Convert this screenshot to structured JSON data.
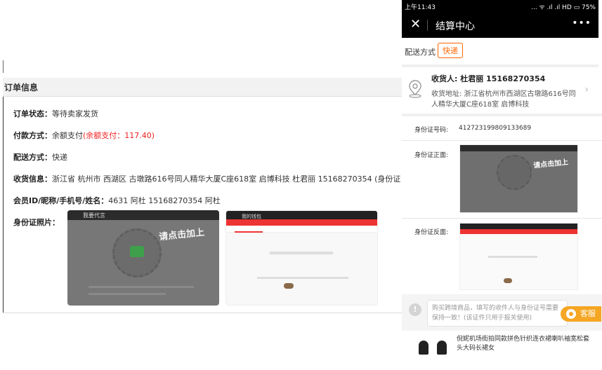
{
  "order": {
    "header": "订单信息",
    "status": {
      "label": "订单状态：",
      "value": "等待卖家发货"
    },
    "payment": {
      "label": "付款方式：",
      "value": "余额支付",
      "extra": "(余额支付：117.40)"
    },
    "shipping": {
      "label": "配送方式：",
      "value": "快递"
    },
    "receiver": {
      "label": "收货信息：",
      "value": "浙江省 杭州市 西湖区 古墩路616号同人精华大厦C座618室 启博科技    杜君丽    15168270354    (身份证"
    },
    "member": {
      "label": "会员ID/昵称/手机号/姓名：",
      "value": "4631   阿杜    15168270354   阿杜"
    },
    "id_photo": {
      "label": "身份证照片："
    },
    "photo_front_text": {
      "title": "我要代言",
      "banner": "请点击加上"
    },
    "photo_back_text": {
      "title": "我的钱包"
    }
  },
  "phone": {
    "status_time": "上午11:43",
    "status_right": "... ᯤ .ıl .ıl HD ▭ 75%",
    "nav_title": "结算中心",
    "nav_more": "•••",
    "ship_label": "配送方式",
    "ship_tag": "快递",
    "consignee": "收货人:  杜君丽   15168270354",
    "address": "收货地址:  浙江省杭州市西湖区古墩路616号同人精华大厦C座618室 启博科技",
    "id_number_label": "身份证号码:",
    "id_number": "412723199809133689",
    "id_front_label": "身份证正面:",
    "id_back_label": "身份证反面:",
    "notice": "购买跨境商品，填写的收件人与身份证号需要保持一致！(该证件只用于报关使用)",
    "service_label": "客服",
    "product_title": "倪妮机场街拍同款拼色针织连衣裙喇叭袖宽松套头大码长裙女"
  },
  "colors": {
    "accent": "#ff6600",
    "price_red": "#ee2222",
    "service": "#f5a623"
  },
  "icons": [
    "close-icon",
    "more-icon",
    "location-pin-icon",
    "chevron-right-icon",
    "info-icon",
    "headset-icon"
  ]
}
